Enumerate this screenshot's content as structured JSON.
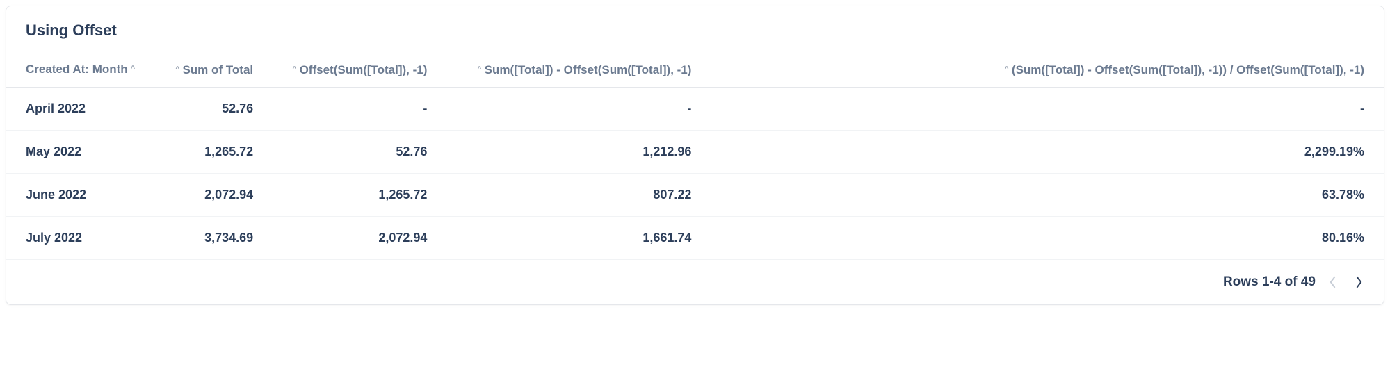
{
  "title": "Using Offset",
  "columns": [
    {
      "label": "Created At: Month",
      "align": "left",
      "caretPos": "after"
    },
    {
      "label": "Sum of Total",
      "align": "right",
      "caretPos": "before"
    },
    {
      "label": "Offset(Sum([Total]), -1)",
      "align": "right",
      "caretPos": "before"
    },
    {
      "label": "Sum([Total]) - Offset(Sum([Total]), -1)",
      "align": "right",
      "caretPos": "before"
    },
    {
      "label": "(Sum([Total]) - Offset(Sum([Total]), -1)) / Offset(Sum([Total]), -1)",
      "align": "right",
      "caretPos": "before"
    }
  ],
  "rows": [
    {
      "month": "April 2022",
      "sum": "52.76",
      "offset": "-",
      "diff": "-",
      "pct": "-"
    },
    {
      "month": "May 2022",
      "sum": "1,265.72",
      "offset": "52.76",
      "diff": "1,212.96",
      "pct": "2,299.19%"
    },
    {
      "month": "June 2022",
      "sum": "2,072.94",
      "offset": "1,265.72",
      "diff": "807.22",
      "pct": "63.78%"
    },
    {
      "month": "July 2022",
      "sum": "3,734.69",
      "offset": "2,072.94",
      "diff": "1,661.74",
      "pct": "80.16%"
    }
  ],
  "footer": {
    "rowsText": "Rows 1-4 of 49"
  },
  "chart_data": {
    "type": "table",
    "title": "Using Offset",
    "columns": [
      "Created At: Month",
      "Sum of Total",
      "Offset(Sum([Total]), -1)",
      "Sum([Total]) - Offset(Sum([Total]), -1)",
      "(Sum([Total]) - Offset(Sum([Total]), -1)) / Offset(Sum([Total]), -1)"
    ],
    "data": [
      [
        "April 2022",
        52.76,
        null,
        null,
        null
      ],
      [
        "May 2022",
        1265.72,
        52.76,
        1212.96,
        22.9919
      ],
      [
        "June 2022",
        2072.94,
        1265.72,
        807.22,
        0.6378
      ],
      [
        "July 2022",
        3734.69,
        2072.94,
        1661.74,
        0.8016
      ]
    ]
  }
}
